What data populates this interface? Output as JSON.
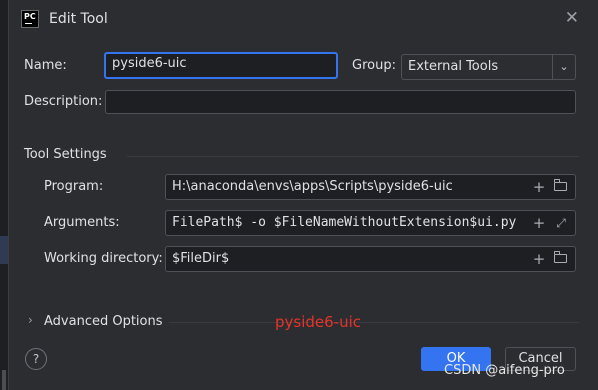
{
  "window": {
    "title": "Edit Tool",
    "app_logo_text": "PC"
  },
  "form": {
    "name_label": "Name:",
    "name_value": "pyside6-uic",
    "group_label": "Group:",
    "group_value": "External Tools",
    "description_label": "Description:",
    "description_value": ""
  },
  "tool_settings": {
    "title": "Tool Settings",
    "program_label": "Program:",
    "program_value": "H:\\anaconda\\envs\\apps\\Scripts\\pyside6-uic",
    "arguments_label": "Arguments:",
    "arguments_value": "FilePath$ -o $FileNameWithoutExtension$ui.py",
    "workdir_label": "Working directory:",
    "workdir_value": "$FileDir$"
  },
  "advanced": {
    "label": "Advanced Options"
  },
  "annotation": {
    "text": "pyside6-uic",
    "color": "#e8332a"
  },
  "buttons": {
    "ok": "OK",
    "cancel": "Cancel",
    "help": "?"
  },
  "watermark": {
    "text": "CSDN @aifeng-pro"
  },
  "icons": {
    "close": "close-icon",
    "plus": "plus-icon",
    "folder": "folder-icon",
    "expand": "expand-icon",
    "chevron": "chevron-right-icon"
  },
  "colors": {
    "accent": "#3574f0",
    "background": "#2b2d30",
    "field": "#1e1f22"
  }
}
